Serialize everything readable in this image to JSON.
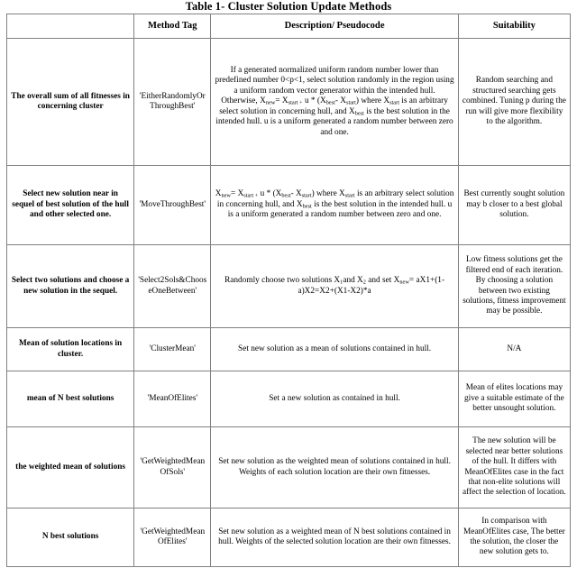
{
  "caption": "Table 1- Cluster Solution Update Methods",
  "table": {
    "headers": {
      "col1": "",
      "col2": "Method Tag",
      "col3": "Description/ Pseudocode",
      "col4": "Suitability"
    },
    "rows": [
      {
        "label": "The overall sum of all fitnesses in concerning cluster",
        "tag": "'EitherRandomlyOrThroughBest'",
        "description": "If a generated normalized uniform random number lower than predefined number 0<p<1, select solution randomly in the region using a uniform random vector generator within the intended hull. Otherwise, Xnew= Xstart + u * (Xbest- Xstart) where Xstart is an arbitrary select solution in concerning hull, and Xbest is the best solution in the intended hull. u is a uniform generated a random number between zero and one.",
        "suitability": "Random searching and structured searching gets combined. Tuning p during the run will give more flexibility to the algorithm."
      },
      {
        "label": "Select new solution near in sequel of best solution of the hull and other selected one.",
        "tag": "'MoveThroughBest'",
        "description": "Xnew= Xstart + u * (Xbest- Xstart) where Xstart is an arbitrary select solution in concerning hull, and Xbest is the best solution in the intended hull. u is a uniform generated a random number between zero and one.",
        "suitability": "Best currently sought solution may b closer to a best global solution."
      },
      {
        "label": "Select two solutions and choose a new solution in the sequel.",
        "tag": "'Select2Sols&ChooseOneBetween'",
        "description": "Randomly choose two solutions X1and X2 and set Xnew= aX1+(1-a)X2=X2+(X1-X2)*a",
        "suitability": "Low fitness solutions get the filtered end of each iteration. By choosing a solution between two existing solutions, fitness improvement may be possible."
      },
      {
        "label": "Mean of solution locations in cluster.",
        "tag": "'ClusterMean'",
        "description": "Set new solution as a mean of solutions contained in hull.",
        "suitability": "N/A"
      },
      {
        "label": "mean of N best solutions",
        "tag": "'MeanOfElites'",
        "description": "Set a new solution as contained in hull.",
        "suitability": "Mean of elites locations may give a suitable estimate of the better unsought solution."
      },
      {
        "label": "the weighted mean of solutions",
        "tag": "'GetWeightedMeanOfSols'",
        "description": "Set new solution as the weighted mean of solutions contained in hull. Weights of each solution location are their own fitnesses.",
        "suitability": "The new solution will be selected near better solutions of the hull. It differs with MeanOfElites case in the fact that non-elite solutions will affect the selection of location."
      },
      {
        "label": "N best solutions",
        "tag": "'GetWeightedMeanOfElites'",
        "description": "Set new solution as a weighted mean of N best solutions contained in hull. Weights of the selected solution location are their own fitnesses.",
        "suitability": "In comparison with MeanOfElites case, The better the solution, the closer the new solution gets to."
      }
    ]
  }
}
